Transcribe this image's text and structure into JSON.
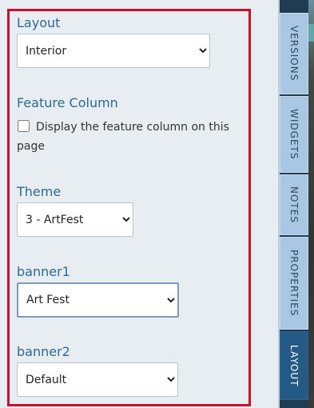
{
  "layout": {
    "label": "Layout",
    "selected": "Interior"
  },
  "feature_column": {
    "label": "Feature Column",
    "checkbox_label": "Display the feature column on this page",
    "checked": false
  },
  "theme": {
    "label": "Theme",
    "selected": "3 - ArtFest"
  },
  "banner1": {
    "label": "banner1",
    "selected": "Art Fest"
  },
  "banner2": {
    "label": "banner2",
    "selected": "Default"
  },
  "sidebar": {
    "tabs": [
      {
        "label": "VERSIONS",
        "active": false
      },
      {
        "label": "WIDGETS",
        "active": false
      },
      {
        "label": "NOTES",
        "active": false
      },
      {
        "label": "PROPERTIES",
        "active": false
      },
      {
        "label": "LAYOUT",
        "active": true
      }
    ]
  },
  "colors": {
    "panel_border": "#c8102e",
    "label_text": "#2b6a93",
    "tab_inactive": "#a9c7e3",
    "tab_active": "#245a84"
  }
}
